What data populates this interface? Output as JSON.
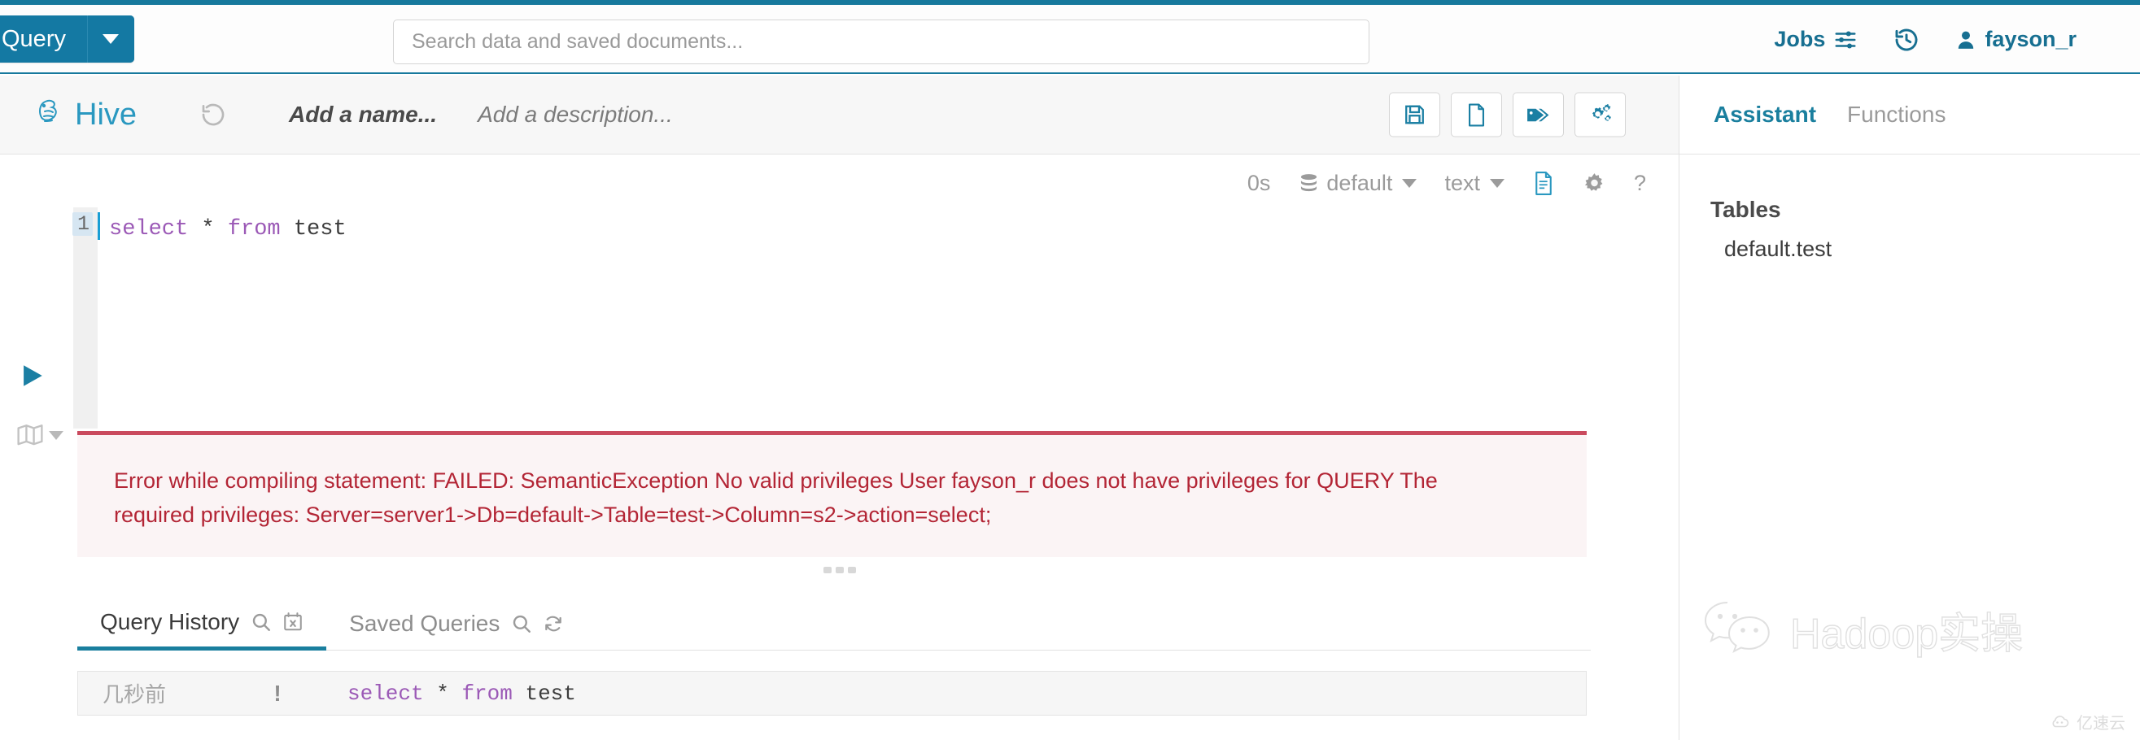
{
  "navbar": {
    "query_button_label": "Query",
    "search_placeholder": "Search data and saved documents...",
    "jobs_label": "Jobs",
    "user_label": "fayson_r",
    "accent_color": "#17799d"
  },
  "app_header": {
    "product_name": "Hive",
    "doc_name_placeholder": "Add a name...",
    "doc_description_placeholder": "Add a description...",
    "tools": [
      {
        "name": "save-button",
        "icon": "floppy-disk-icon"
      },
      {
        "name": "new-document-button",
        "icon": "document-icon"
      },
      {
        "name": "tags-button",
        "icon": "tags-icon"
      },
      {
        "name": "settings-button",
        "icon": "gears-icon"
      }
    ]
  },
  "editor_toolbar": {
    "duration": "0s",
    "database": "default",
    "result_format": "text",
    "help_label": "?"
  },
  "editor": {
    "line_number": "1",
    "tokens": [
      {
        "text": "select",
        "type": "keyword"
      },
      {
        "text": " * ",
        "type": "plain"
      },
      {
        "text": "from",
        "type": "keyword"
      },
      {
        "text": " test",
        "type": "plain"
      }
    ],
    "statement": "select * from test"
  },
  "error": {
    "line1": "Error while compiling statement: FAILED: SemanticException No valid privileges User fayson_r does not have privileges for QUERY The",
    "line2": "required privileges: Server=server1->Db=default->Table=test->Column=s2->action=select;",
    "border_color": "#ca4a5e",
    "text_color": "#b32535"
  },
  "bottom_tabs": [
    {
      "label": "Query History",
      "active": true,
      "icons": [
        "search-icon",
        "calendar-clear-icon"
      ]
    },
    {
      "label": "Saved Queries",
      "active": false,
      "icons": [
        "search-icon",
        "refresh-icon"
      ]
    }
  ],
  "history_rows": [
    {
      "time": "几秒前",
      "status": "!",
      "sql_tokens": [
        {
          "text": "select",
          "type": "keyword"
        },
        {
          "text": " * ",
          "type": "plain"
        },
        {
          "text": "from",
          "type": "keyword"
        },
        {
          "text": " test",
          "type": "plain"
        }
      ]
    }
  ],
  "right_panel": {
    "tabs": [
      {
        "label": "Assistant",
        "active": true
      },
      {
        "label": "Functions",
        "active": false
      }
    ],
    "section_title": "Tables",
    "items": [
      "default.test"
    ]
  },
  "watermark": {
    "text": "Hadoop实操",
    "corner_text": "亿速云"
  }
}
